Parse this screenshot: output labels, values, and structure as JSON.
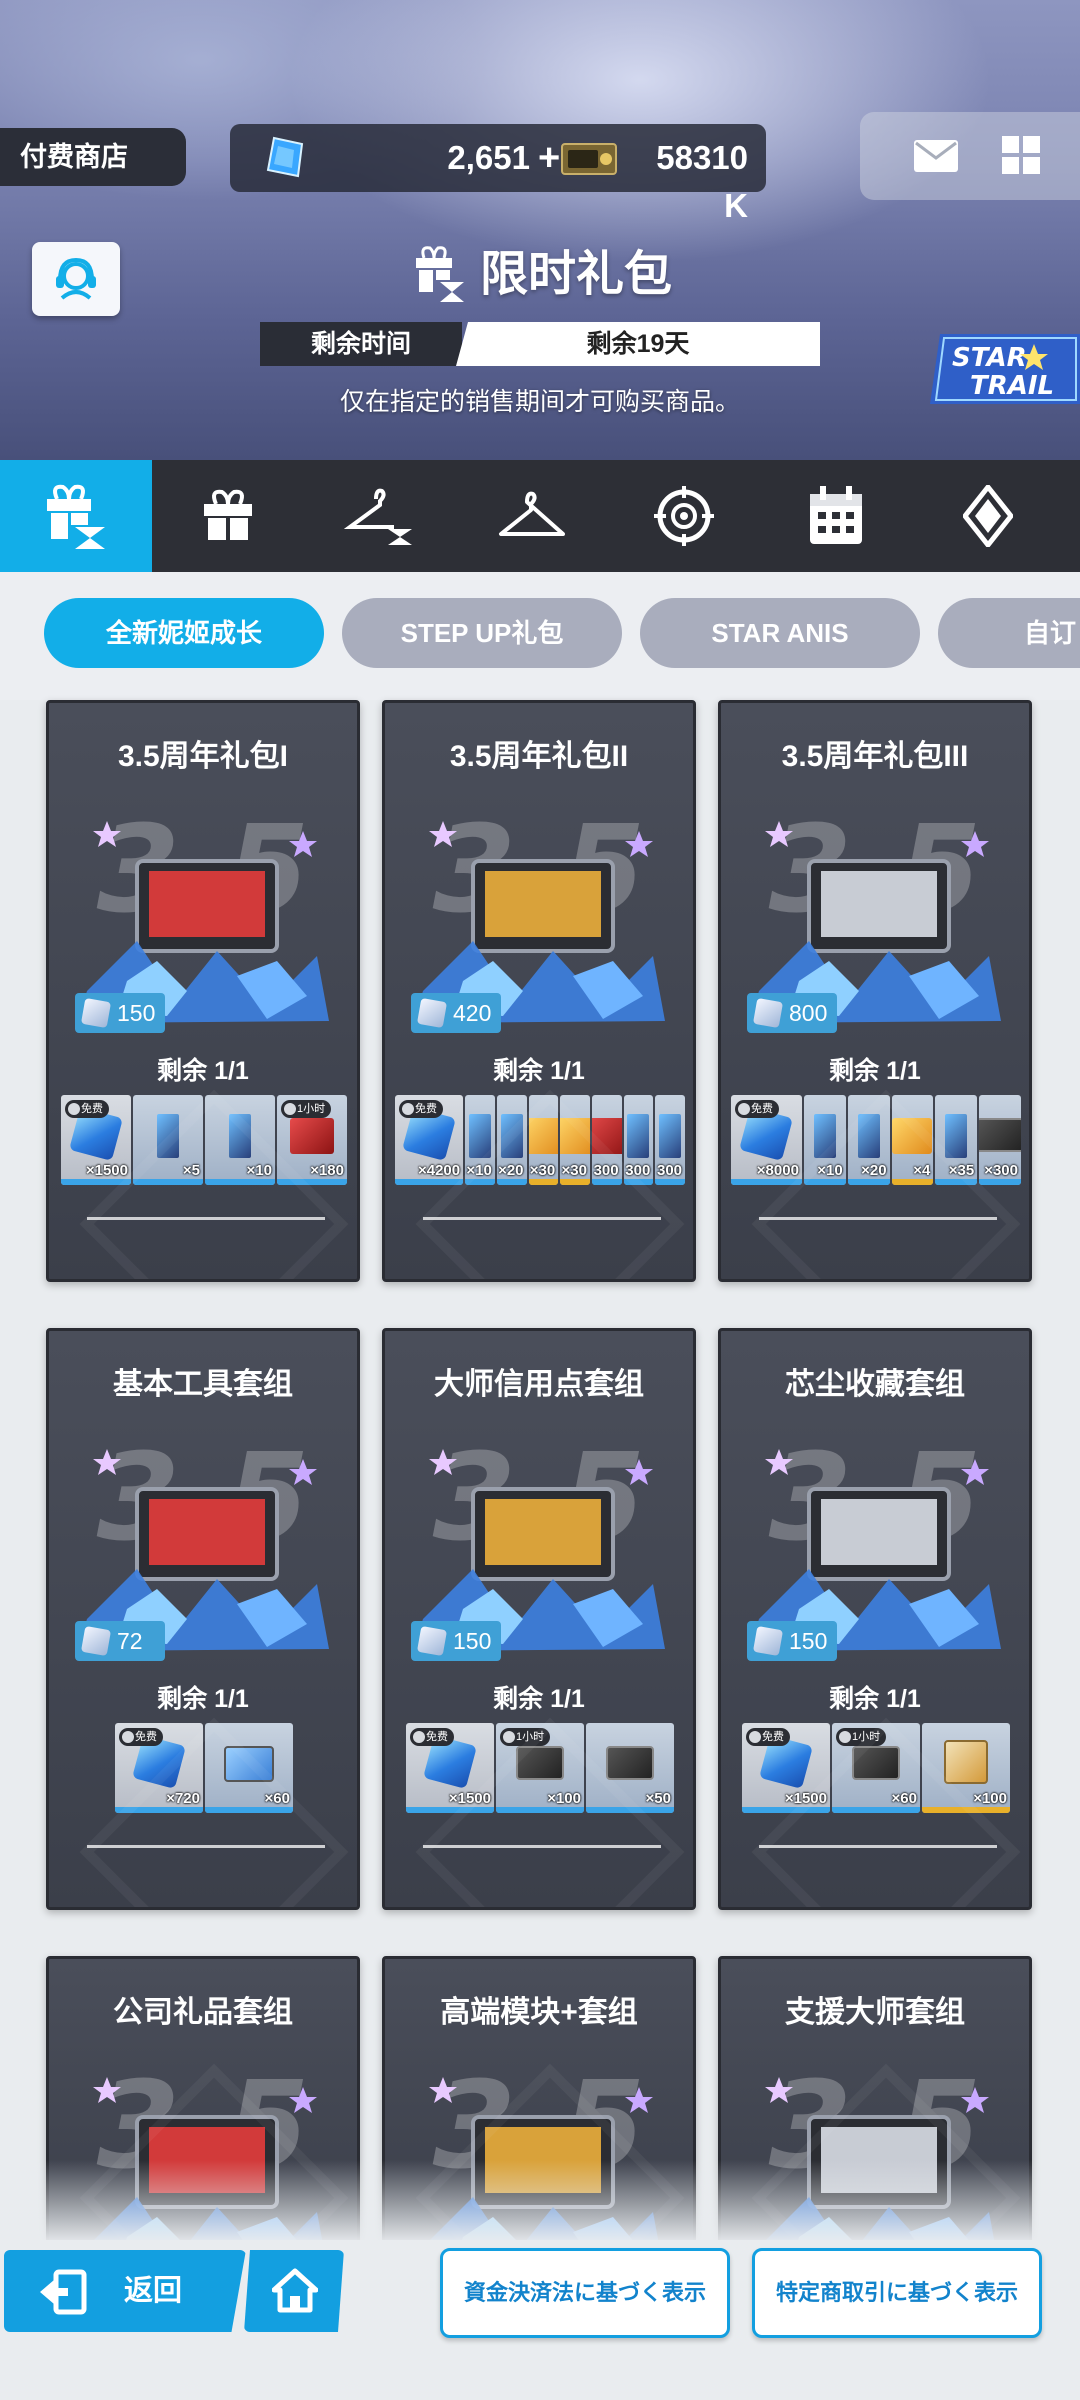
{
  "header": {
    "shop_label": "付费商店",
    "gems": "2,651",
    "plus": "+",
    "credits": "58310 K",
    "title": "限时礼包",
    "remain_label": "剩余时间",
    "remain_value": "剩余19天",
    "notice": "仅在指定的销售期间才可购买商品。",
    "event_logo": "STAR TRAIL"
  },
  "category_tabs": [
    {
      "icon": "gift-hourglass-icon",
      "active": true
    },
    {
      "icon": "gift-icon",
      "active": false
    },
    {
      "icon": "hanger-hourglass-icon",
      "active": false
    },
    {
      "icon": "hanger-icon",
      "active": false
    },
    {
      "icon": "target-icon",
      "active": false
    },
    {
      "icon": "calendar-icon",
      "active": false
    },
    {
      "icon": "diamond-emblem-icon",
      "active": false
    }
  ],
  "sub_tabs": [
    {
      "label": "全新妮姬成长",
      "active": true
    },
    {
      "label": "STEP UP礼包",
      "active": false
    },
    {
      "label": "STAR ANIS",
      "active": false
    },
    {
      "label": "自订",
      "active": false
    }
  ],
  "cards": [
    {
      "title": "3.5周年礼包I",
      "price": "150",
      "remain": "剩余 1/1",
      "items": [
        {
          "tag": "免费",
          "qty": "×1500",
          "kind": "gem"
        },
        {
          "qty": "×5",
          "kind": "card"
        },
        {
          "qty": "×10",
          "kind": "card"
        },
        {
          "tag": "1小时",
          "qty": "×180",
          "kind": "red"
        }
      ]
    },
    {
      "title": "3.5周年礼包II",
      "price": "420",
      "remain": "剩余 1/1",
      "items": [
        {
          "tag": "免费",
          "qty": "×4200",
          "kind": "gem"
        },
        {
          "qty": "×10",
          "kind": "card"
        },
        {
          "qty": "×20",
          "kind": "card"
        },
        {
          "qty": "×30",
          "kind": "gold"
        },
        {
          "qty": "×30",
          "kind": "gold"
        },
        {
          "qty": "300",
          "kind": "red"
        },
        {
          "qty": "300",
          "kind": "card"
        },
        {
          "qty": "300",
          "kind": "card"
        }
      ]
    },
    {
      "title": "3.5周年礼包III",
      "price": "800",
      "remain": "剩余 1/1",
      "items": [
        {
          "tag": "免费",
          "qty": "×8000",
          "kind": "gem"
        },
        {
          "qty": "×10",
          "kind": "card"
        },
        {
          "qty": "×20",
          "kind": "card"
        },
        {
          "qty": "×4",
          "kind": "gold"
        },
        {
          "qty": "×35",
          "kind": "card"
        },
        {
          "qty": "×300",
          "kind": "case"
        }
      ]
    },
    {
      "title": "基本工具套组",
      "price": "72",
      "remain": "剩余 1/1",
      "items": [
        {
          "tag": "免费",
          "qty": "×720",
          "kind": "gem"
        },
        {
          "qty": "×60",
          "kind": "toolbox"
        }
      ]
    },
    {
      "title": "大师信用点套组",
      "price": "150",
      "remain": "剩余 1/1",
      "items": [
        {
          "tag": "免费",
          "qty": "×1500",
          "kind": "gem"
        },
        {
          "tag": "1小时",
          "qty": "×100",
          "kind": "case"
        },
        {
          "qty": "×50",
          "kind": "case"
        }
      ]
    },
    {
      "title": "芯尘收藏套组",
      "price": "150",
      "remain": "剩余 1/1",
      "items": [
        {
          "tag": "免费",
          "qty": "×1500",
          "kind": "gem"
        },
        {
          "tag": "1小时",
          "qty": "×60",
          "kind": "case"
        },
        {
          "qty": "×100",
          "kind": "box"
        }
      ]
    },
    {
      "title": "公司礼品套组"
    },
    {
      "title": "高端模块+套组"
    },
    {
      "title": "支援大师套组"
    }
  ],
  "bottom": {
    "back_label": "返回",
    "legal_1": "資金決済法に基づく表示",
    "legal_2": "特定商取引に基づく表示"
  },
  "colors": {
    "accent": "#12aee8",
    "tab_bar": "#2d2f36",
    "card_bg": "#3f434e",
    "inactive_pill": "#a9adbd"
  }
}
